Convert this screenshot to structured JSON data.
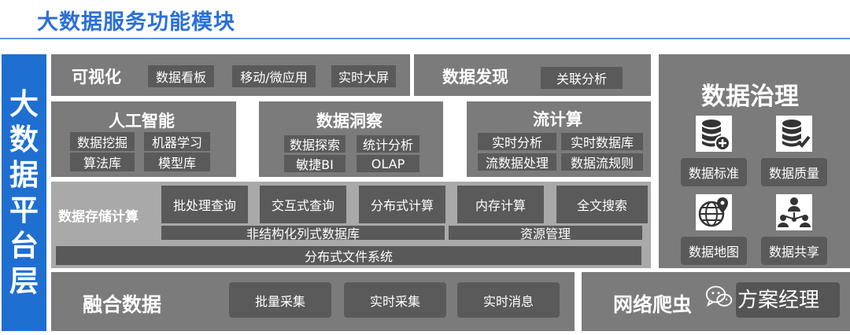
{
  "title": "大数据服务功能模块",
  "side_label": "大数据平台层",
  "visualization": {
    "heading": "可视化",
    "items": [
      "数据看板",
      "移动/微应用",
      "实时大屏"
    ]
  },
  "discovery": {
    "heading": "数据发现",
    "items": [
      "关联分析"
    ]
  },
  "ai": {
    "heading": "人工智能",
    "items": [
      "数据挖掘",
      "机器学习",
      "算法库",
      "模型库"
    ]
  },
  "insight": {
    "heading": "数据洞察",
    "items": [
      "数据探索",
      "统计分析",
      "敏捷BI",
      "OLAP"
    ]
  },
  "stream": {
    "heading": "流计算",
    "items": [
      "实时分析",
      "实时数据库",
      "流数据处理",
      "数据流规则"
    ]
  },
  "storage": {
    "heading": "数据存储计算",
    "items": [
      "批处理查询",
      "交互式查询",
      "分布式计算",
      "内存计算",
      "全文搜索"
    ],
    "nosql": "非结构化列式数据库",
    "resource": "资源管理",
    "dfs": "分布式文件系统"
  },
  "governance": {
    "heading": "数据治理",
    "items": [
      {
        "label": "数据标准",
        "icon": "database-plus-icon"
      },
      {
        "label": "数据质量",
        "icon": "database-check-icon"
      },
      {
        "label": "数据地图",
        "icon": "globe-pin-icon"
      },
      {
        "label": "数据共享",
        "icon": "people-network-icon"
      }
    ]
  },
  "fusion": {
    "heading": "融合数据",
    "items": [
      "批量采集",
      "实时采集",
      "实时消息"
    ]
  },
  "crawler": {
    "heading": "网络爬虫"
  },
  "watermark": {
    "text": "方案经理"
  },
  "colors": {
    "title": "#2b6fd6",
    "side_bar": "#1f6fd1",
    "panel": "#7b7b7b",
    "chip": "#5a5a5a",
    "rule": "#5a97e0"
  }
}
